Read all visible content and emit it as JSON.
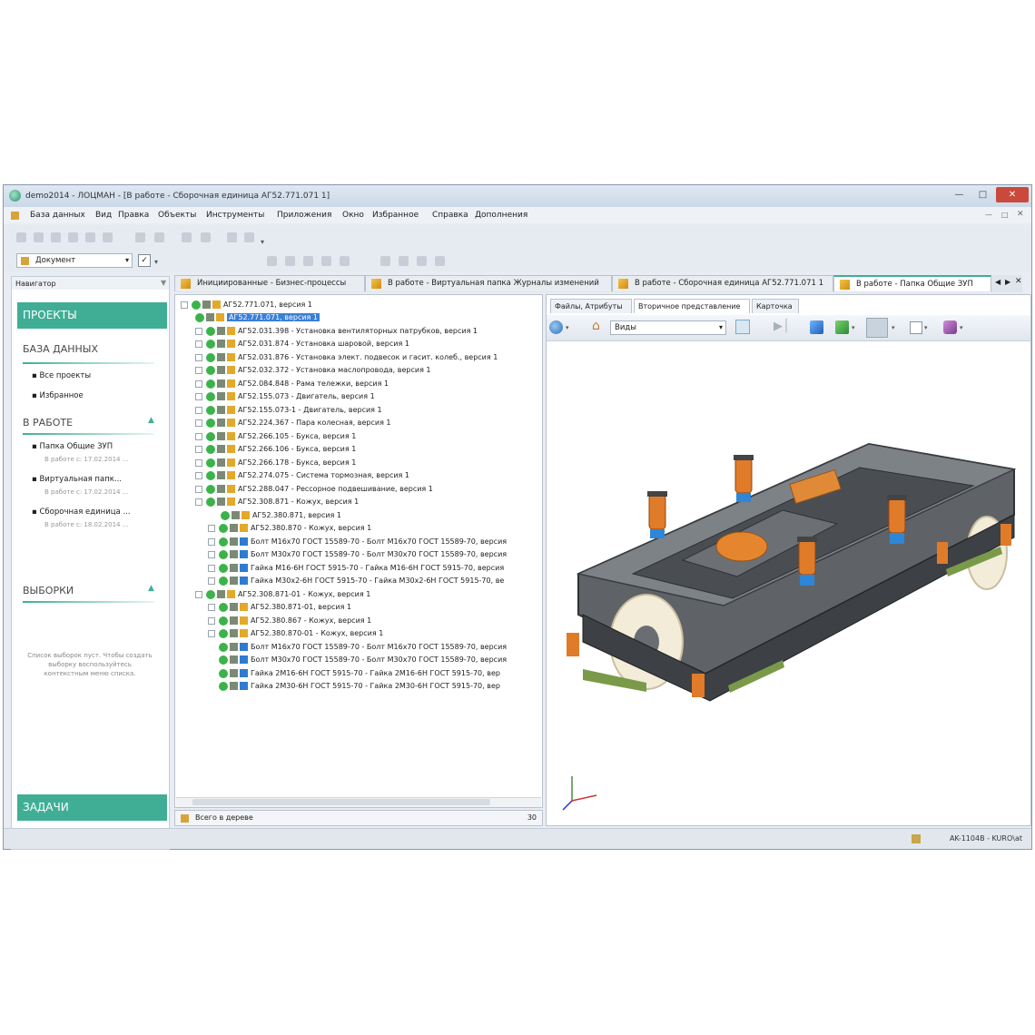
{
  "window": {
    "title": "demo2014 - ЛОЦМАН - [В работе - Сборочная единица АГ52.771.071 1]",
    "menu": [
      "База данных",
      "Вид",
      "Правка",
      "Объекты",
      "Инструменты",
      "Приложения",
      "Окно",
      "Избранное",
      "Справка",
      "Дополнения"
    ],
    "doc_select": "Документ"
  },
  "nav": {
    "header": "Навигатор",
    "projects": "ПРОЕКТЫ",
    "db": {
      "title": "БАЗА ДАННЫХ",
      "items": [
        "Все проекты",
        "Избранное"
      ]
    },
    "work": {
      "title": "В РАБОТЕ",
      "items": [
        {
          "name": "Папка Общие ЗУП",
          "date": "В работе с: 17.02.2014 ..."
        },
        {
          "name": "Виртуальная папк...",
          "date": "В работе с: 17.02.2014 ..."
        },
        {
          "name": "Сборочная единица ...",
          "date": "В работе с: 18.02.2014 ..."
        }
      ]
    },
    "selections": {
      "title": "ВЫБОРКИ",
      "empty": "Список выборок пуст. Чтобы создать выборку воспользуйтесь контекстным меню списка."
    },
    "tasks": "ЗАДАЧИ"
  },
  "tabs": [
    "Инициированные - Бизнес-процессы",
    "В работе - Виртуальная папка Журналы изменений",
    "В работе - Сборочная единица АГ52.771.071 1",
    "В работе - Папка Общие ЗУП"
  ],
  "tree": {
    "rows": [
      {
        "text": "АГ52.771.071, версия 1"
      },
      {
        "text": "АГ52.771.071, версия 1"
      },
      {
        "text": "АГ52.031.398 - Установка вентиляторных патрубков, версия 1"
      },
      {
        "text": "АГ52.031.874 - Установка шаровой, версия 1"
      },
      {
        "text": "АГ52.031.876 - Установка элект. подвесок и гасит. колеб., версия 1"
      },
      {
        "text": "АГ52.032.372 - Установка маслопровода, версия 1"
      },
      {
        "text": "АГ52.084.848 - Рама тележки, версия 1"
      },
      {
        "text": "АГ52.155.073 - Двигатель, версия 1"
      },
      {
        "text": "АГ52.155.073-1 - Двигатель, версия 1"
      },
      {
        "text": "АГ52.224.367 - Пара колесная, версия 1"
      },
      {
        "text": "АГ52.266.105 - Букса, версия 1"
      },
      {
        "text": "АГ52.266.106 - Букса, версия 1"
      },
      {
        "text": "АГ52.266.178 - Букса, версия 1"
      },
      {
        "text": "АГ52.274.075 - Система тормозная, версия 1"
      },
      {
        "text": "АГ52.288.047 - Рессорное подвешивание, версия 1"
      },
      {
        "text": "АГ52.308.871 - Кожух, версия 1"
      },
      {
        "text": "АГ52.380.871, версия 1"
      },
      {
        "text": "АГ52.380.870 - Кожух, версия 1"
      },
      {
        "text": "Болт М16х70 ГОСТ 15589-70 - Болт М16х70 ГОСТ 15589-70, версия"
      },
      {
        "text": "Болт М30х70 ГОСТ 15589-70 - Болт М30х70 ГОСТ 15589-70, версия"
      },
      {
        "text": "Гайка М16-6Н ГОСТ 5915-70 - Гайка М16-6Н ГОСТ 5915-70, версия"
      },
      {
        "text": "Гайка М30х2-6Н ГОСТ 5915-70 - Гайка М30х2-6Н ГОСТ 5915-70, ве"
      },
      {
        "text": "АГ52.308.871-01 - Кожух, версия 1"
      },
      {
        "text": "АГ52.380.871-01, версия 1"
      },
      {
        "text": "АГ52.380.867 - Кожух, версия 1"
      },
      {
        "text": "АГ52.380.870-01 - Кожух, версия 1"
      },
      {
        "text": "Болт М16х70 ГОСТ 15589-70 - Болт М16х70 ГОСТ 15589-70, версия"
      },
      {
        "text": "Болт М30х70 ГОСТ 15589-70 - Болт М30х70 ГОСТ 15589-70, версия"
      },
      {
        "text": "Гайка 2М16-6Н ГОСТ 5915-70 - Гайка 2М16-6Н ГОСТ 5915-70, вер"
      },
      {
        "text": "Гайка 2М30-6Н ГОСТ 5915-70 - Гайка 2М30-6Н ГОСТ 5915-70, вер"
      }
    ],
    "footer_label": "Всего в дереве",
    "footer_count": "30"
  },
  "right": {
    "tabs": [
      "Файлы, Атрибуты",
      "Вторичное представление",
      "Карточка"
    ],
    "views_select": "Виды"
  },
  "status": {
    "text": "AK-1104B - KURO\\at"
  },
  "colors": {
    "accent": "#3fae95",
    "selection": "#3a7fd8",
    "frame": "#5e6266",
    "wheel": "#f3ecd9",
    "spring": "#e07b2a"
  }
}
